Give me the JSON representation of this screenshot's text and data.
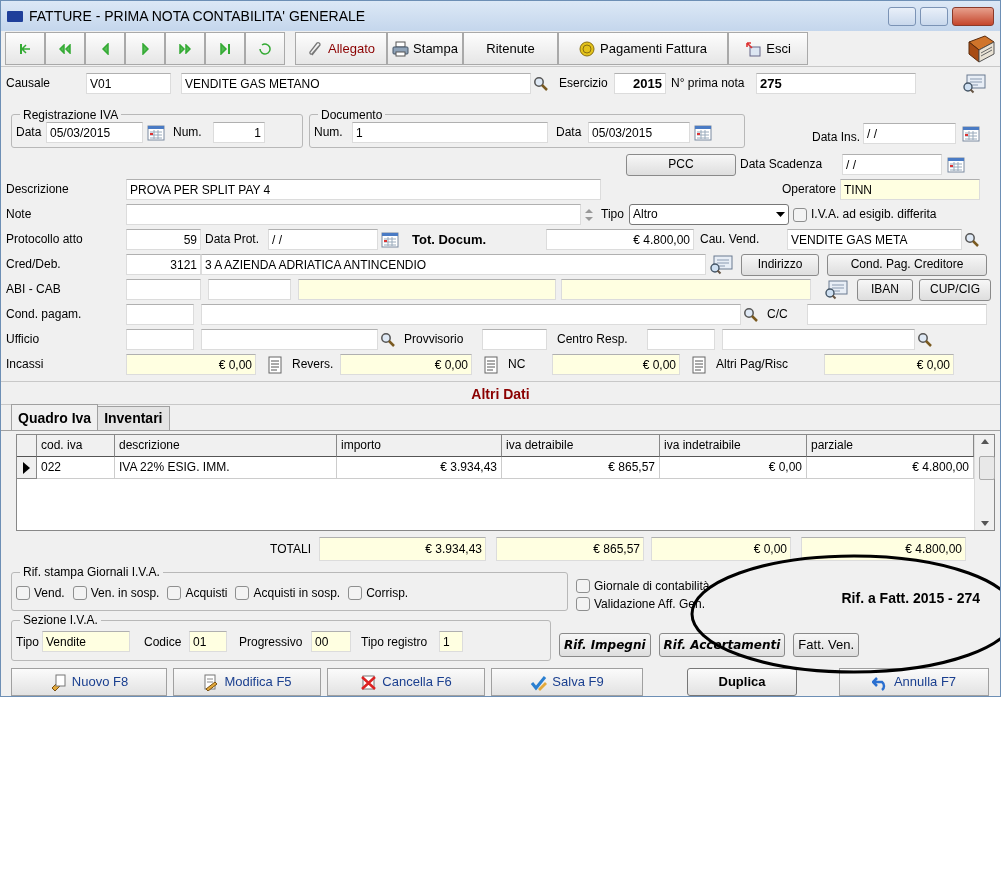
{
  "window": {
    "title": "FATTURE - PRIMA NOTA CONTABILITA' GENERALE"
  },
  "toolbar": [
    {
      "label": "Allegato"
    },
    {
      "label": "Stampa"
    },
    {
      "label": "Ritenute"
    },
    {
      "label": "Pagamenti Fattura"
    },
    {
      "label": "Esci"
    }
  ],
  "causale": {
    "label": "Causale",
    "code": "V01",
    "description": "VENDITE GAS METANO"
  },
  "esercizio": {
    "label": "Esercizio",
    "value": "2015"
  },
  "prima_nota": {
    "label": "N° prima nota",
    "value": "275"
  },
  "registrazione_iva": {
    "title": "Registrazione IVA",
    "data_label": "Data",
    "data": "05/03/2015",
    "num_label": "Num.",
    "num": "1"
  },
  "documento": {
    "title": "Documento",
    "num_label": "Num.",
    "num": "1",
    "data_label": "Data",
    "data": "05/03/2015"
  },
  "data_ins": {
    "label": "Data Ins.",
    "value": "/ /"
  },
  "pcc_button": "PCC",
  "data_scadenza": {
    "label": "Data Scadenza",
    "value": "/ /"
  },
  "descrizione": {
    "label": "Descrizione",
    "value": "PROVA PER SPLIT PAY 4"
  },
  "operatore": {
    "label": "Operatore",
    "value": "TINN"
  },
  "note": {
    "label": "Note"
  },
  "tipo": {
    "label": "Tipo",
    "value": "Altro"
  },
  "iva_differita": {
    "label": "I.V.A. ad esigib. differita",
    "checked": false
  },
  "protocollo": {
    "label": "Protocollo atto",
    "value": "59"
  },
  "data_prot": {
    "label": "Data Prot.",
    "value": "/ /"
  },
  "tot_docum": {
    "label": "Tot. Docum.",
    "value": "€ 4.800,00"
  },
  "cau_vend": {
    "label": "Cau. Vend.",
    "value": "VENDITE GAS META"
  },
  "cred_deb": {
    "label": "Cred/Deb.",
    "code": "3121",
    "name": "3 A AZIENDA ADRIATICA ANTINCENDIO"
  },
  "cred_buttons": [
    "Indirizzo",
    "Cond. Pag. Creditore"
  ],
  "abi_cab": {
    "label": "ABI - CAB"
  },
  "abi_buttons": [
    "IBAN",
    "CUP/CIG"
  ],
  "cond_pagam": {
    "label": "Cond. pagam."
  },
  "cc": {
    "label": "C/C"
  },
  "ufficio": {
    "label": "Ufficio"
  },
  "provvisorio": {
    "label": "Provvisorio"
  },
  "centro_resp": {
    "label": "Centro Resp."
  },
  "incassi": [
    {
      "label": "Incassi",
      "value": "€ 0,00"
    },
    {
      "label": "Revers.",
      "value": "€ 0,00"
    },
    {
      "label": "NC",
      "value": "€ 0,00"
    },
    {
      "label": "Altri Pag/Risc",
      "value": "€ 0,00"
    }
  ],
  "section_title": "Altri Dati",
  "tabs": [
    {
      "label": "Quadro Iva",
      "selected": true
    },
    {
      "label": "Inventari",
      "selected": false
    }
  ],
  "table": {
    "columns": [
      "cod. iva",
      "descrizione",
      "importo",
      "iva detraibile",
      "iva indetraibile",
      "parziale"
    ],
    "rows": [
      {
        "selected": true,
        "cells": [
          "022",
          "IVA 22% ESIG. IMM.",
          "€ 3.934,43",
          "€ 865,57",
          "€ 0,00",
          "€ 4.800,00"
        ]
      }
    ]
  },
  "totali": {
    "label": "TOTALI",
    "values": [
      "€ 3.934,43",
      "€ 865,57",
      "€ 0,00",
      "€ 4.800,00"
    ]
  },
  "giornali": {
    "title": "Rif. stampa Giornali I.V.A.",
    "options": [
      {
        "label": "Vend.",
        "checked": false
      },
      {
        "label": "Ven. in sosp.",
        "checked": false
      },
      {
        "label": "Acquisti",
        "checked": false
      },
      {
        "label": "Acquisti in sosp.",
        "checked": false
      },
      {
        "label": "Corrisp.",
        "checked": false
      }
    ]
  },
  "other_checks": [
    {
      "label": "Giornale di contabilità",
      "checked": false
    },
    {
      "label": "Validazione Aff. Gen.",
      "checked": false
    }
  ],
  "rif_fattura": "Rif. a Fatt. 2015 - 274",
  "sezione_iva": {
    "title": "Sezione I.V.A.",
    "fields": [
      {
        "label": "Tipo",
        "value": "Vendite"
      },
      {
        "label": "Codice",
        "value": "01"
      },
      {
        "label": "Progressivo",
        "value": "00"
      },
      {
        "label": "Tipo registro",
        "value": "1"
      }
    ]
  },
  "rif_buttons": [
    {
      "label": "Rif. Impegni",
      "kind": "emphasis"
    },
    {
      "label": "Rif. Accertamenti",
      "kind": "emphasis"
    },
    {
      "label": "Fatt. Ven.",
      "kind": "plain"
    }
  ],
  "actions": [
    {
      "label": "Nuovo F8",
      "kind": "icon"
    },
    {
      "label": "Modifica F5",
      "kind": "icon"
    },
    {
      "label": "Cancella F6",
      "kind": "icon"
    },
    {
      "label": "Salva F9",
      "kind": "icon"
    },
    {
      "label": "Duplica",
      "kind": "emphasis"
    },
    {
      "label": "Annulla F7",
      "kind": "icon"
    }
  ]
}
